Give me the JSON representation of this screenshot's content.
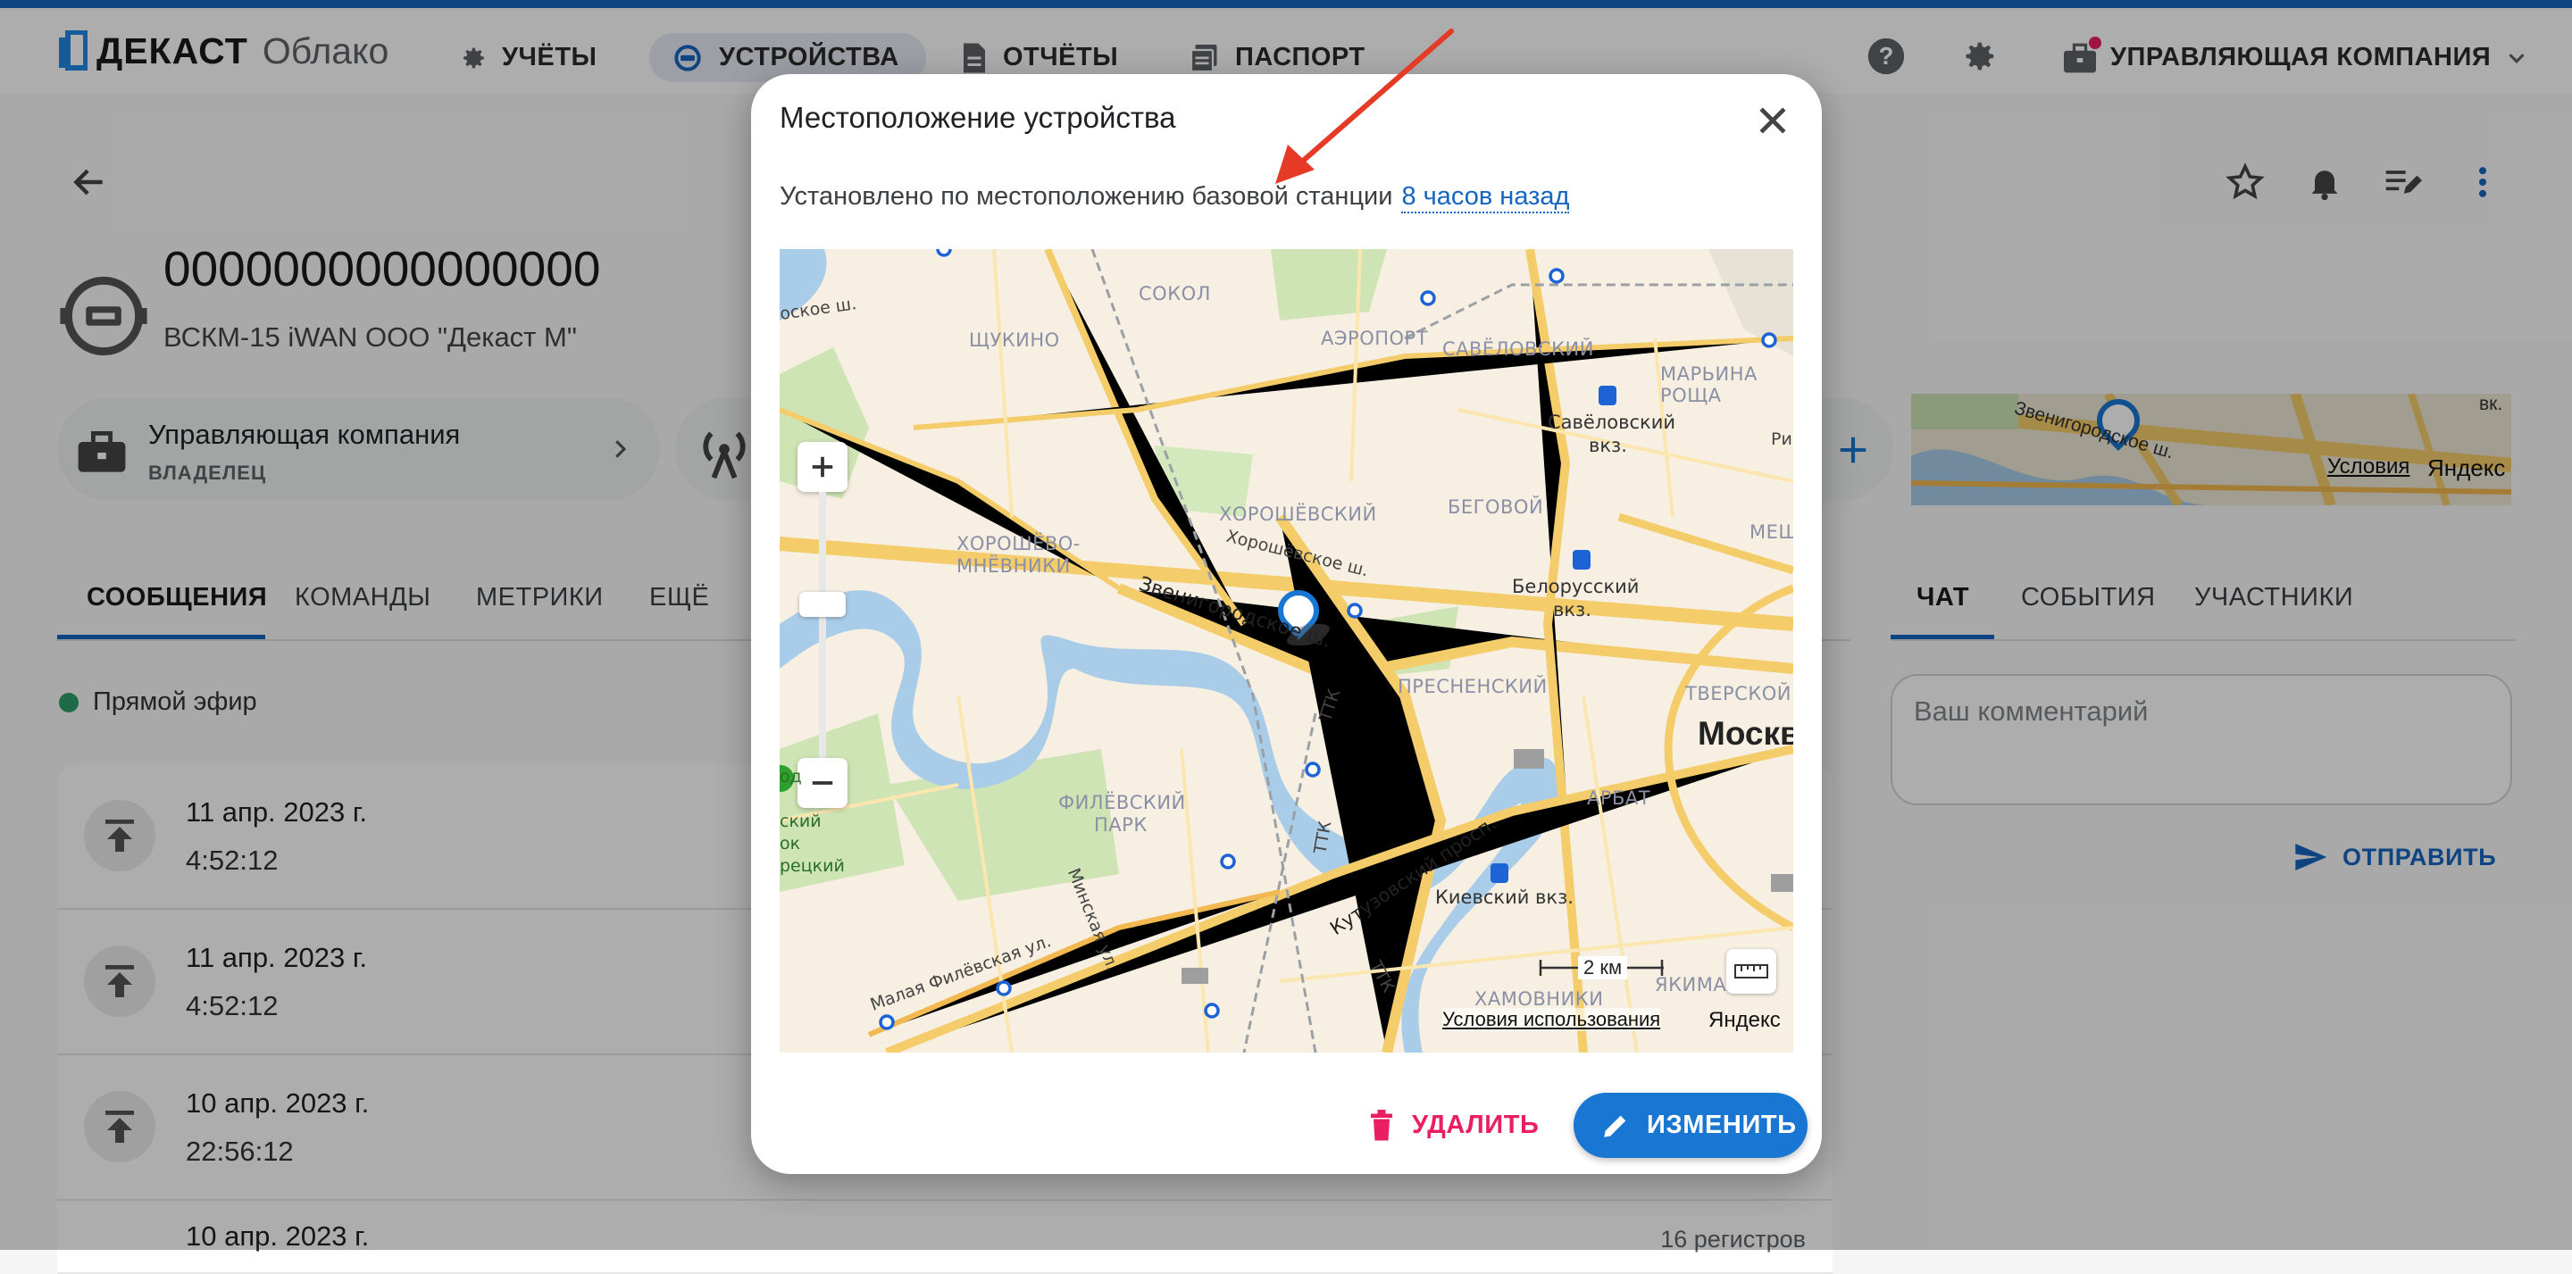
{
  "header": {
    "logo_word": "ДЕКАСТ",
    "logo_suffix": "Облако",
    "nav": [
      {
        "label": "УЧЁТЫ",
        "icon": "gear-outline-icon"
      },
      {
        "label": "УСТРОЙСТВА",
        "icon": "device-icon"
      },
      {
        "label": "ОТЧЁТЫ",
        "icon": "document-icon"
      },
      {
        "label": "ПАСПОРТ",
        "icon": "passport-icon"
      }
    ],
    "company_menu": "УПРАВЛЯЮЩАЯ КОМПАНИЯ"
  },
  "device": {
    "serial": "0000000000000000",
    "model": "ВСКМ-15 iWAN ООО \"Декаст М\""
  },
  "owner_chip": {
    "name": "Управляющая компания",
    "role": "ВЛАДЕЛЕЦ"
  },
  "left_tabs": [
    "СООБЩЕНИЯ",
    "КОМАНДЫ",
    "МЕТРИКИ",
    "ЕЩЁ"
  ],
  "live_label": "Прямой эфир",
  "messages": [
    {
      "date": "11 апр. 2023 г.",
      "time": "4:52:12"
    },
    {
      "date": "11 апр. 2023 г.",
      "time": "4:52:12"
    },
    {
      "date": "10 апр. 2023 г.",
      "time": "22:56:12"
    },
    {
      "date": "10 апр. 2023 г.",
      "time": "",
      "registers": "16 регистров"
    }
  ],
  "right_tabs": [
    "ЧАТ",
    "СОБЫТИЯ",
    "УЧАСТНИКИ"
  ],
  "comment_placeholder": "Ваш комментарий",
  "send_label": "ОТПРАВИТЬ",
  "mini_map": {
    "street": "Звенигородское ш.",
    "short": "вк.",
    "terms": "Условия",
    "brand": "Яндекс"
  },
  "dialog": {
    "title": "Местоположение устройства",
    "subtitle": "Установлено по местоположению базовой станции",
    "time_link": "8 часов назад",
    "delete_label": "УДАЛИТЬ",
    "edit_label": "ИЗМЕНИТЬ"
  },
  "map": {
    "districts": [
      "СОКОЛ",
      "АЭРОПОРТ",
      "САВЁЛОВСКИЙ",
      "МАРЬИНА РОЩА",
      "ЩУКИНО",
      "ХОРОШЁВСКИЙ",
      "БЕГОВОЙ",
      "ХОРОШЁВО-",
      "МНЁВНИКИ",
      "ПРЕСНЕНСКИЙ",
      "ТВЕРСКОЙ",
      "МЕЩ",
      "ФИЛЁВСКИЙ",
      "ПАРК",
      "АРБАТ",
      "ХАМОВНИКИ",
      "ЯКИМА"
    ],
    "stations": [
      "Савёловский",
      "вкз.",
      "Белорусский",
      "вкз.",
      "Киевский вкз."
    ],
    "streets": [
      "Хорошёвское ш.",
      "Звенигородское ш.",
      "ТТК",
      "ТТК",
      "ТТК",
      "Кутузовский просп.",
      "Минская ул.",
      "Малая Филёвская ул.",
      "оское ш.",
      "Ри"
    ],
    "edge_labels": [
      "од",
      "ский",
      "ок",
      "рецкий"
    ],
    "city": "Москв",
    "scale": "2 км",
    "terms": "Условия использования",
    "brand": "Яндекс"
  },
  "colors": {
    "accent": "#1976d2",
    "danger": "#e91e63",
    "live": "#2e9e6b"
  }
}
